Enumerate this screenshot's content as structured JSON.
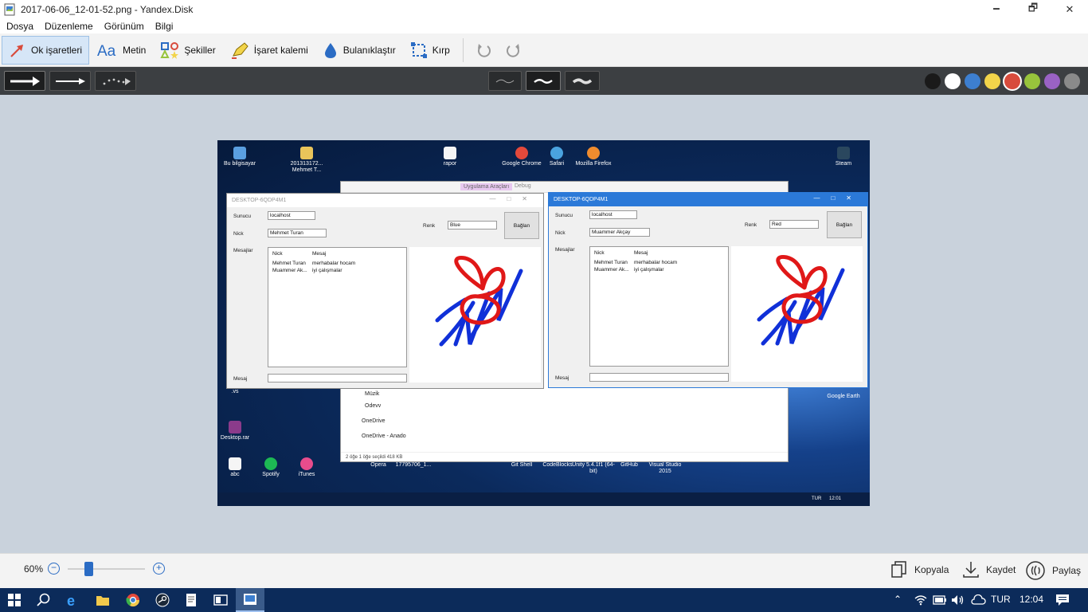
{
  "window": {
    "title": "2017-06-06_12-01-52.png - Yandex.Disk",
    "minimize": "🗕",
    "restore": "🗗",
    "close": "✕"
  },
  "menu": [
    "Dosya",
    "Düzenleme",
    "Görünüm",
    "Bilgi"
  ],
  "tools": {
    "arrow": "Ok işaretleri",
    "text": "Metin",
    "shapes": "Şekiller",
    "marker": "İşaret kalemi",
    "blur": "Bulanıklaştır",
    "crop": "Kırp"
  },
  "colors": {
    "accent": "#2b6cc4",
    "swatches": [
      "#1a1a1a",
      "#ffffff",
      "#3d7fd0",
      "#f2d44a",
      "#d84b3c",
      "#98c43c",
      "#9a62c4",
      "#8a8a8a"
    ],
    "selected_swatch": 4
  },
  "screenshot": {
    "desktop_icons": [
      {
        "label": "Bu bilgisayar"
      },
      {
        "label": "201313172... Mehmet T..."
      },
      {
        "label": "rapor"
      },
      {
        "label": "Google Chrome"
      },
      {
        "label": "Safari"
      },
      {
        "label": "Mozilla Firefox"
      },
      {
        "label": "Steam"
      },
      {
        "label": "Desktop.rar"
      },
      {
        "label": ".vs"
      },
      {
        "label": "abc"
      },
      {
        "label": "Spotify"
      },
      {
        "label": "iTunes"
      },
      {
        "label": "Opera"
      },
      {
        "label": "17795706_1..."
      },
      {
        "label": "Git Shell"
      },
      {
        "label": "CodeBlocks"
      },
      {
        "label": "Unity 5.4.1f1 (64-bit)"
      },
      {
        "label": "GitHub"
      },
      {
        "label": "Visual Studio 2015"
      },
      {
        "label": "Google Earth"
      }
    ],
    "explorer": {
      "tab_tools": "Uygulama Araçları",
      "tab_debug": "Debug",
      "nav": [
        "Müzik",
        "Odevv",
        "OneDrive",
        "OneDrive - Anado"
      ],
      "status": "2 öğe     1 öğe seçildi  418 KB"
    },
    "chat_left": {
      "title": "DESKTOP-6QDP4M1",
      "server_label": "Sunucu",
      "server_value": "localhost",
      "nick_label": "Nick",
      "nick_value": "Mehmet Turan",
      "color_label": "Renk",
      "color_value": "Blue",
      "connect": "Bağlan",
      "messages_label": "Mesajlar",
      "col_nick": "Nick",
      "col_msg": "Mesaj",
      "rows": [
        {
          "nick": "Mehmet Turan",
          "msg": "merhabalar hocam"
        },
        {
          "nick": "Muammer Ak...",
          "msg": "iyi çalışmalar"
        }
      ],
      "message_label": "Mesaj"
    },
    "chat_right": {
      "title": "DESKTOP-6QDP4M1",
      "server_label": "Sunucu",
      "server_value": "localhost",
      "nick_label": "Nick",
      "nick_value": "Muammer Akçay",
      "color_label": "Renk",
      "color_value": "Red",
      "connect": "Bağlan",
      "messages_label": "Mesajlar",
      "col_nick": "Nick",
      "col_msg": "Mesaj",
      "rows": [
        {
          "nick": "Mehmet Turan",
          "msg": "merhabalar hocam"
        },
        {
          "nick": "Muammer Ak...",
          "msg": "iyi çalışmalar"
        }
      ],
      "message_label": "Mesaj"
    },
    "taskbar": {
      "lang": "TUR",
      "time": "12:01"
    }
  },
  "status": {
    "zoom": "60%",
    "zoom_fraction": 0.6,
    "copy": "Kopyala",
    "save": "Kaydet",
    "share": "Paylaş"
  },
  "taskbar": {
    "lang": "TUR",
    "time": "12:04"
  }
}
